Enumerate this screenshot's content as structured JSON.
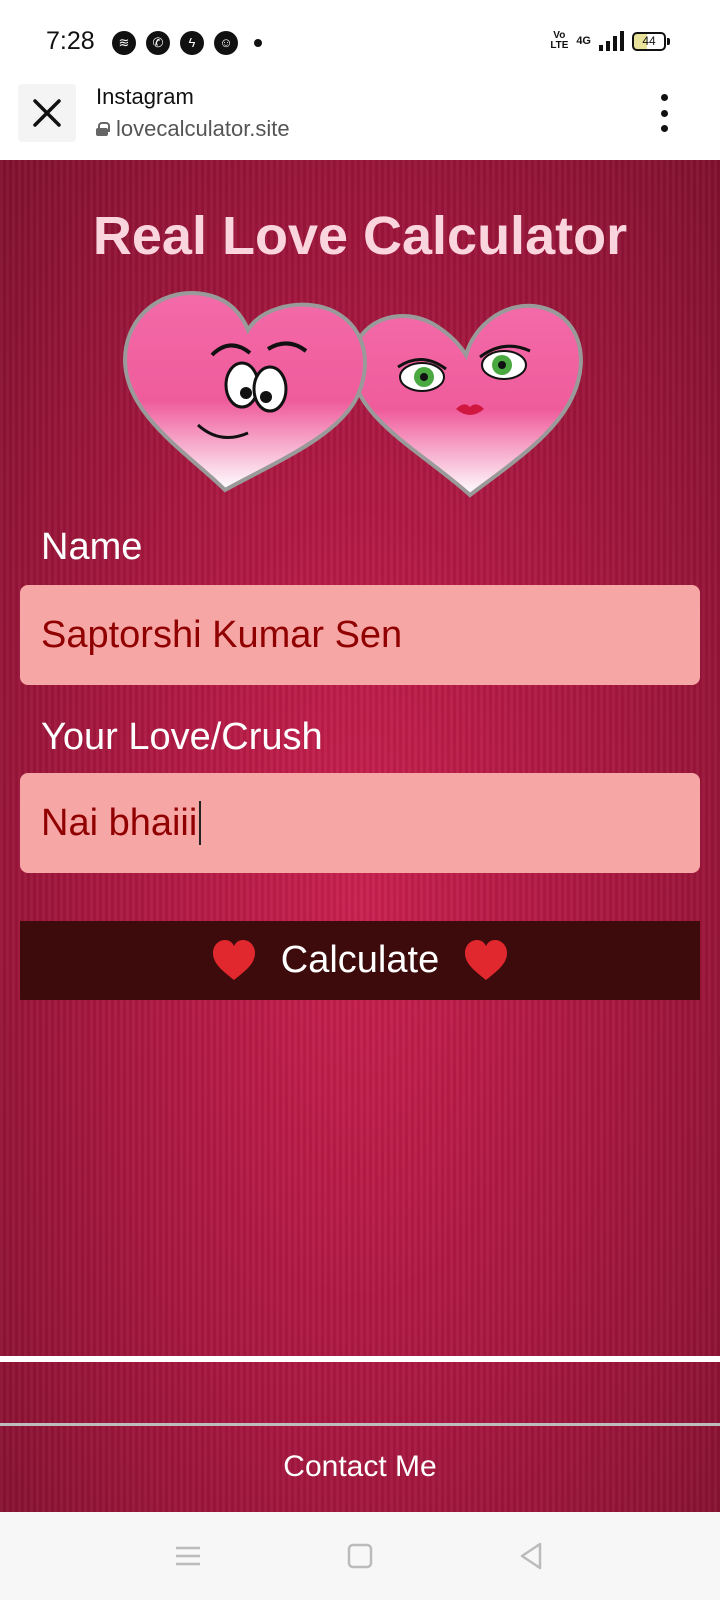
{
  "status_bar": {
    "time": "7:28",
    "notification_icons": [
      "spotify-icon",
      "whatsapp-icon",
      "messenger-icon",
      "chat-icon"
    ],
    "volte": "Vo LTE",
    "network": "4G",
    "battery": "44"
  },
  "browser": {
    "app_title": "Instagram",
    "url": "lovecalculator.site"
  },
  "page": {
    "title": "Real Love Calculator",
    "name_label": "Name",
    "name_value": "Saptorshi Kumar Sen",
    "crush_label": "Your Love/Crush",
    "crush_value": "Nai bhaiii",
    "calculate_label": "Calculate",
    "contact_link": "Contact Me"
  },
  "colors": {
    "page_bg": "#a8173f",
    "title": "#fbd5de",
    "input_bg": "#f7a6a6",
    "input_text": "#900000",
    "button_bg": "#3e0b0d",
    "heart": "#e0282e"
  }
}
